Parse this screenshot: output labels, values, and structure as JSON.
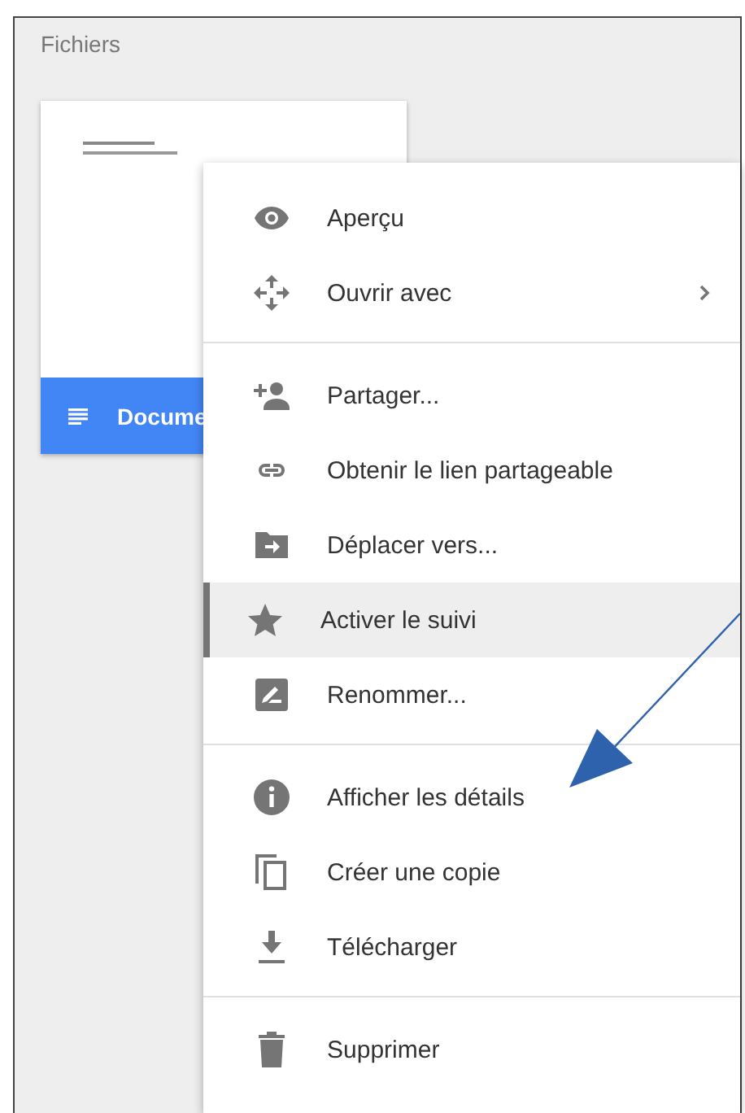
{
  "section_title": "Fichiers",
  "file_card": {
    "name": "Docume"
  },
  "context_menu": {
    "items": [
      {
        "kind": "action",
        "label": "Aperçu",
        "selected": false,
        "submenu": false
      },
      {
        "kind": "action",
        "label": "Ouvrir avec",
        "selected": false,
        "submenu": true
      },
      {
        "kind": "divider"
      },
      {
        "kind": "action",
        "label": "Partager...",
        "selected": false,
        "submenu": false
      },
      {
        "kind": "action",
        "label": "Obtenir le lien partageable",
        "selected": false,
        "submenu": false
      },
      {
        "kind": "action",
        "label": "Déplacer vers...",
        "selected": false,
        "submenu": false
      },
      {
        "kind": "action",
        "label": "Activer le suivi",
        "selected": true,
        "submenu": false
      },
      {
        "kind": "action",
        "label": "Renommer...",
        "selected": false,
        "submenu": false
      },
      {
        "kind": "divider"
      },
      {
        "kind": "action",
        "label": "Afficher les détails",
        "selected": false,
        "submenu": false
      },
      {
        "kind": "action",
        "label": "Créer une copie",
        "selected": false,
        "submenu": false
      },
      {
        "kind": "action",
        "label": "Télécharger",
        "selected": false,
        "submenu": false
      },
      {
        "kind": "divider"
      },
      {
        "kind": "action",
        "label": "Supprimer",
        "selected": false,
        "submenu": false
      }
    ]
  }
}
